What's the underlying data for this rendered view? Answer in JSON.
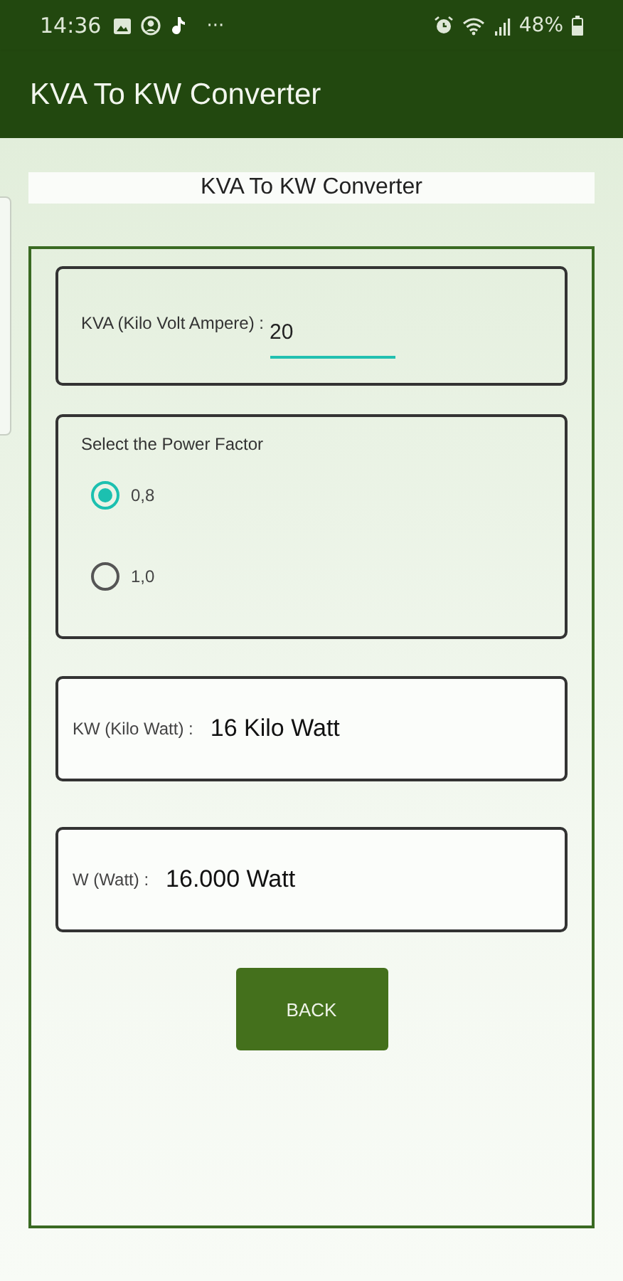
{
  "status_bar": {
    "time": "14:36",
    "more": "···",
    "battery": "48%"
  },
  "app_bar": {
    "title": "KVA To KW Converter"
  },
  "page_title": "KVA To KW Converter",
  "kva": {
    "label": "KVA (Kilo Volt Ampere) :",
    "value": "20"
  },
  "power_factor": {
    "title": "Select the Power Factor",
    "options": [
      {
        "label": "0,8",
        "selected": true
      },
      {
        "label": "1,0",
        "selected": false
      }
    ]
  },
  "results": [
    {
      "label": "KW (Kilo Watt) :",
      "value": "16 Kilo Watt"
    },
    {
      "label": "W (Watt) :",
      "value": "16.000 Watt"
    }
  ],
  "back_button": "BACK"
}
